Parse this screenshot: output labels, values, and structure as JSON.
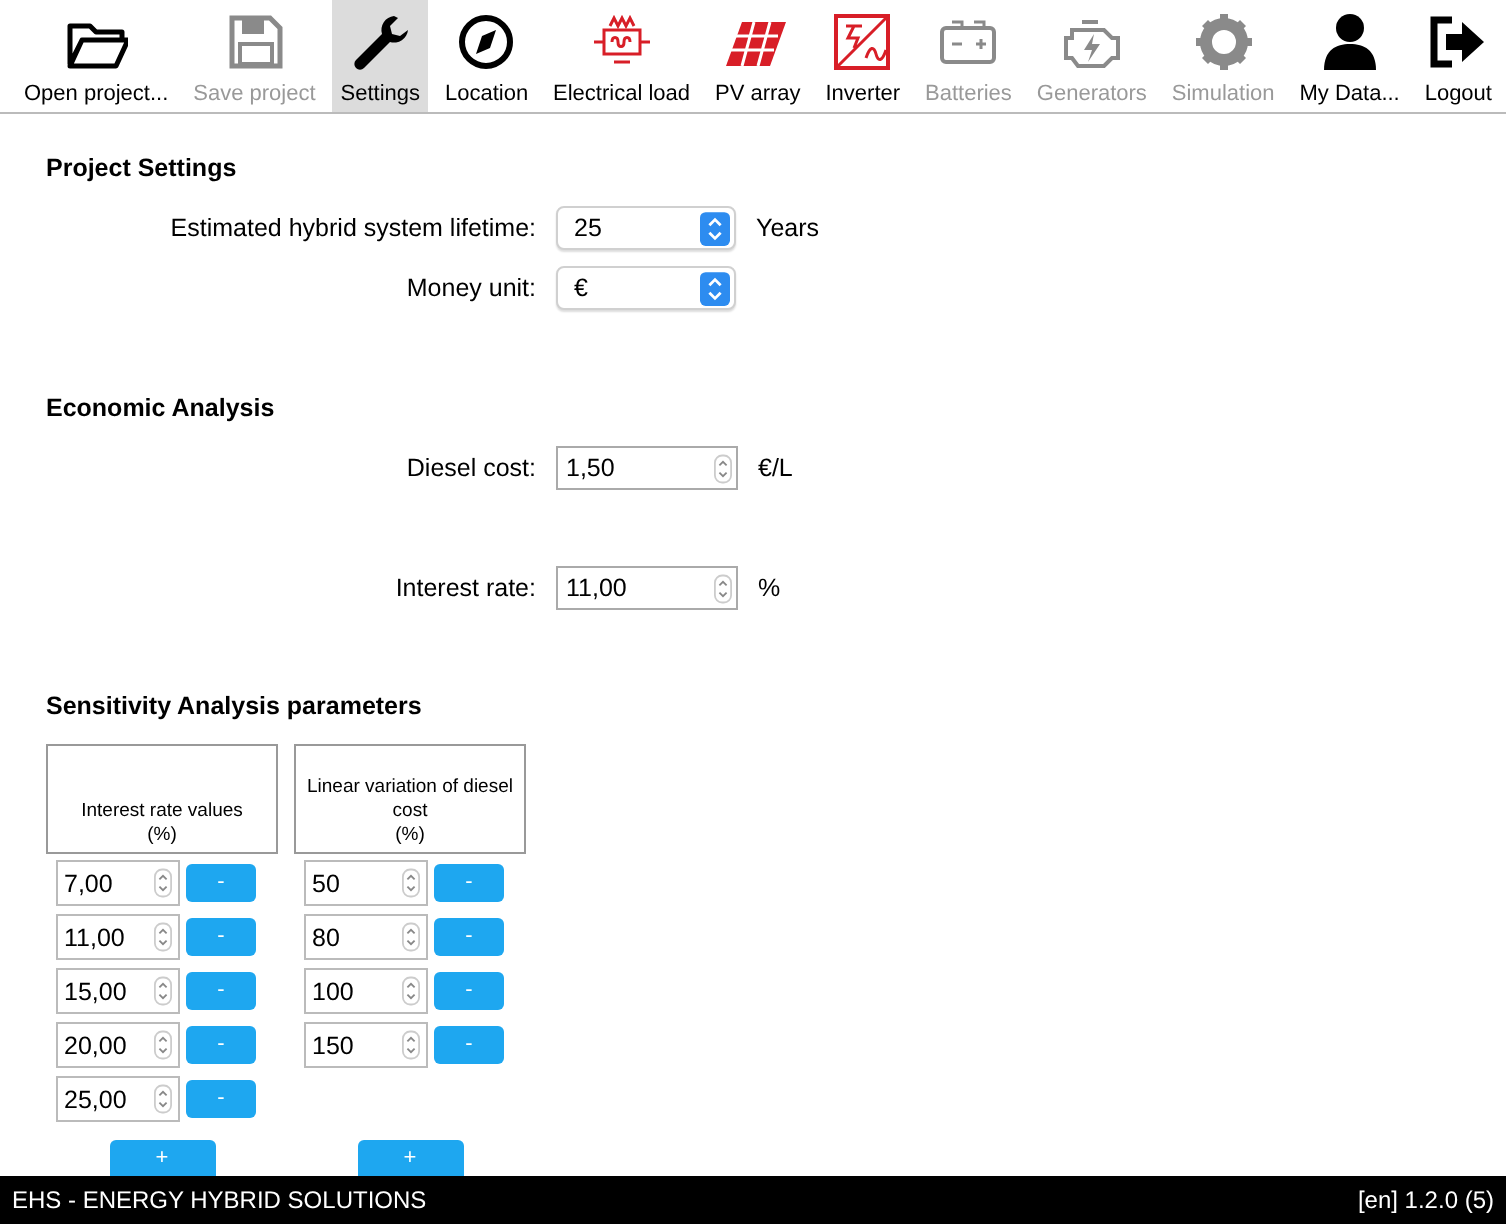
{
  "toolbar": [
    {
      "kind": "folder",
      "label": "Open project...",
      "disabled": false,
      "selected": false
    },
    {
      "kind": "floppy",
      "label": "Save project",
      "disabled": true,
      "selected": false
    },
    {
      "kind": "wrench",
      "label": "Settings",
      "disabled": false,
      "selected": true
    },
    {
      "kind": "compass",
      "label": "Location",
      "disabled": false,
      "selected": false
    },
    {
      "kind": "circuit",
      "label": "Electrical load",
      "disabled": false,
      "selected": false
    },
    {
      "kind": "solar",
      "label": "PV array",
      "disabled": false,
      "selected": false
    },
    {
      "kind": "inverter",
      "label": "Inverter",
      "disabled": false,
      "selected": false
    },
    {
      "kind": "battery",
      "label": "Batteries",
      "disabled": true,
      "selected": false
    },
    {
      "kind": "engine",
      "label": "Generators",
      "disabled": true,
      "selected": false
    },
    {
      "kind": "gear",
      "label": "Simulation",
      "disabled": true,
      "selected": false
    },
    {
      "kind": "person",
      "label": "My Data...",
      "disabled": false,
      "selected": false
    },
    {
      "kind": "logout",
      "label": "Logout",
      "disabled": false,
      "selected": false
    }
  ],
  "sections": [
    {
      "title": "Project Settings",
      "fields": [
        {
          "kind": "select",
          "label": "Estimated hybrid system lifetime:",
          "value": "25",
          "unit": "Years"
        },
        {
          "kind": "select",
          "label": "Money unit:",
          "value": "€"
        }
      ]
    },
    {
      "title": "Economic Analysis",
      "fields": [
        {
          "kind": "number",
          "label": "Diesel cost:",
          "value": "1,50",
          "unit": "€/L"
        },
        {
          "kind": "number",
          "label": "Interest rate:",
          "value": "11,00",
          "unit": "%"
        }
      ]
    }
  ],
  "sensitivity": {
    "title": "Sensitivity Analysis parameters",
    "columns": [
      {
        "heading": "Interest rate values",
        "unit": "(%)",
        "values": [
          "7,00",
          "11,00",
          "15,00",
          "20,00",
          "25,00"
        ],
        "remove_label": "-",
        "add_label": "+"
      },
      {
        "heading": "Linear variation of diesel cost",
        "unit": "(%)",
        "values": [
          "50",
          "80",
          "100",
          "150"
        ],
        "remove_label": "-",
        "add_label": "+"
      }
    ]
  },
  "status_bar": {
    "left": "EHS - ENERGY HYBRID SOLUTIONS",
    "right": "[en] 1.2.0 (5)"
  }
}
